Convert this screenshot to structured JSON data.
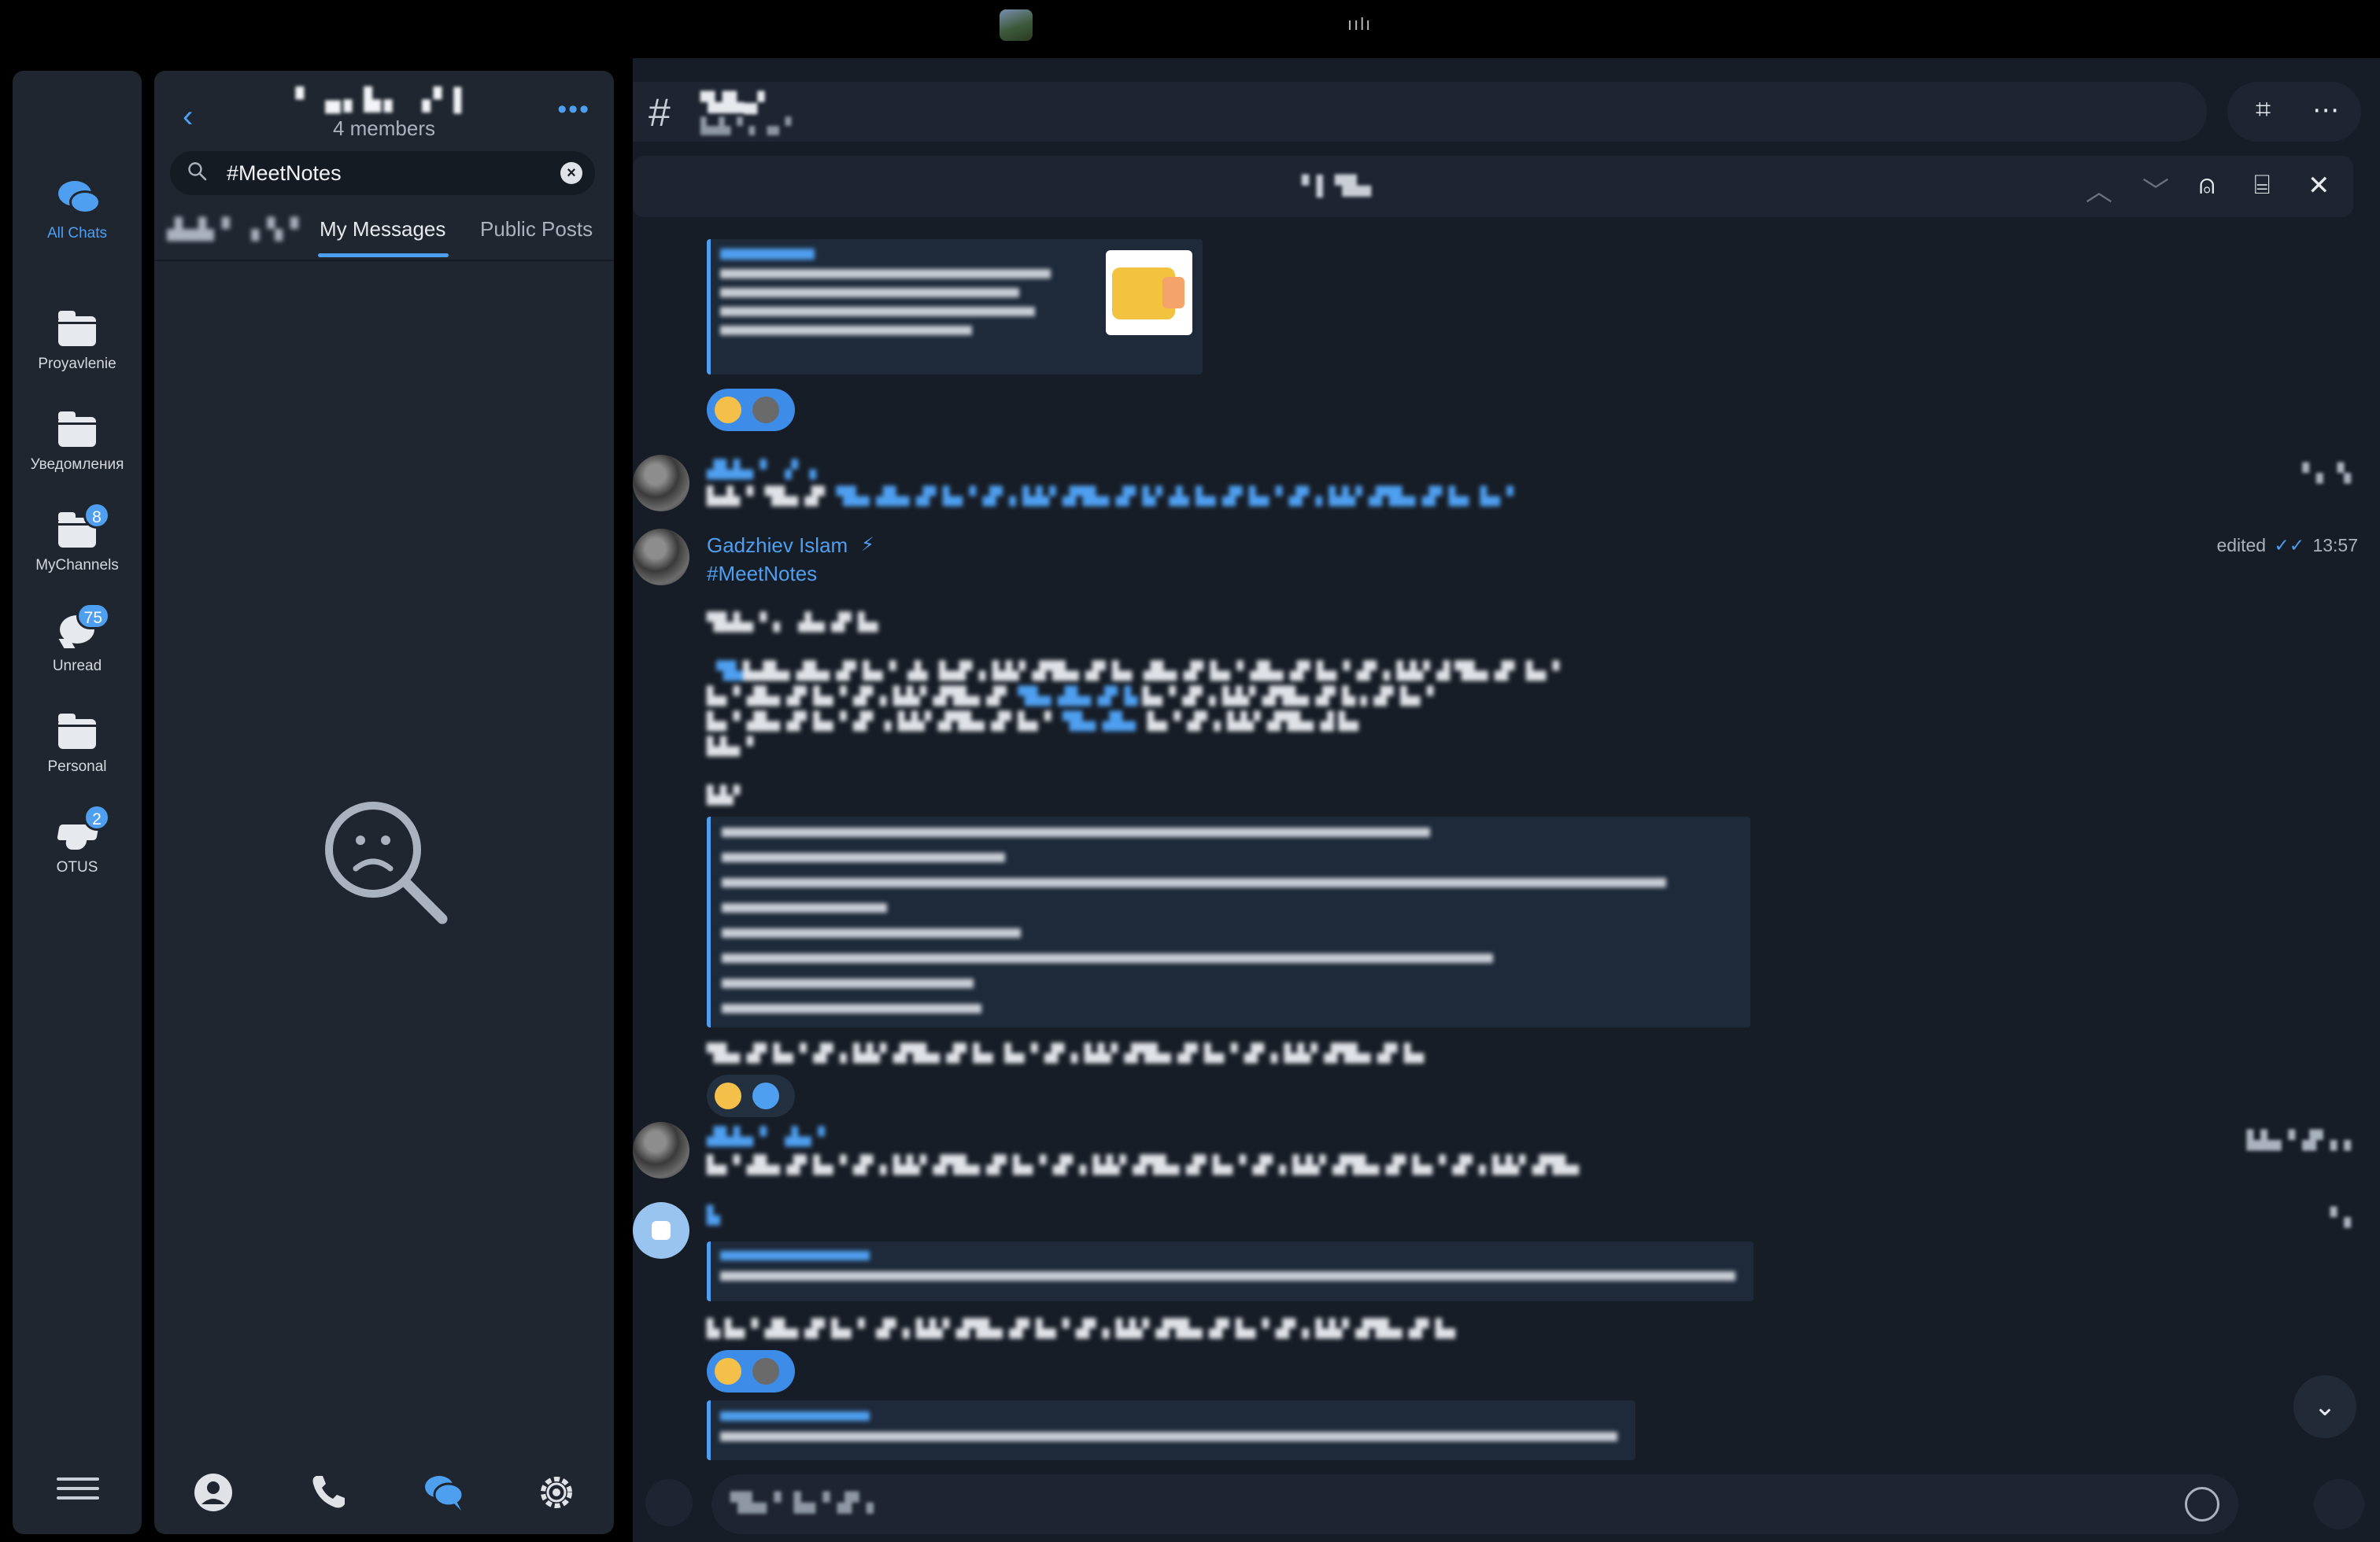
{
  "folders": [
    {
      "label": "All Chats",
      "icon": "chats-icon",
      "active": true
    },
    {
      "label": "Proyavlenie",
      "icon": "folder-icon"
    },
    {
      "label": "Уведомления",
      "icon": "folder-icon"
    },
    {
      "label": "MyChannels",
      "icon": "folder-icon",
      "badge": "8"
    },
    {
      "label": "Unread",
      "icon": "chat-bubble-icon",
      "badge": "75"
    },
    {
      "label": "Personal",
      "icon": "folder-icon"
    },
    {
      "label": "OTUS",
      "icon": "graduation-cap-icon",
      "badge": "2"
    }
  ],
  "panel": {
    "members": "4 members",
    "search_value": "#MeetNotes",
    "tabs": [
      "My Messages",
      "Public Posts"
    ]
  },
  "messages": {
    "m1": {
      "author": "Gadzhiev Islam",
      "tag": "#MeetNotes",
      "edited": "edited",
      "time": "13:57"
    }
  },
  "colors": {
    "accent": "#4f9ff0",
    "panel_bg": "#1f2630",
    "chat_bg": "#171d26"
  }
}
